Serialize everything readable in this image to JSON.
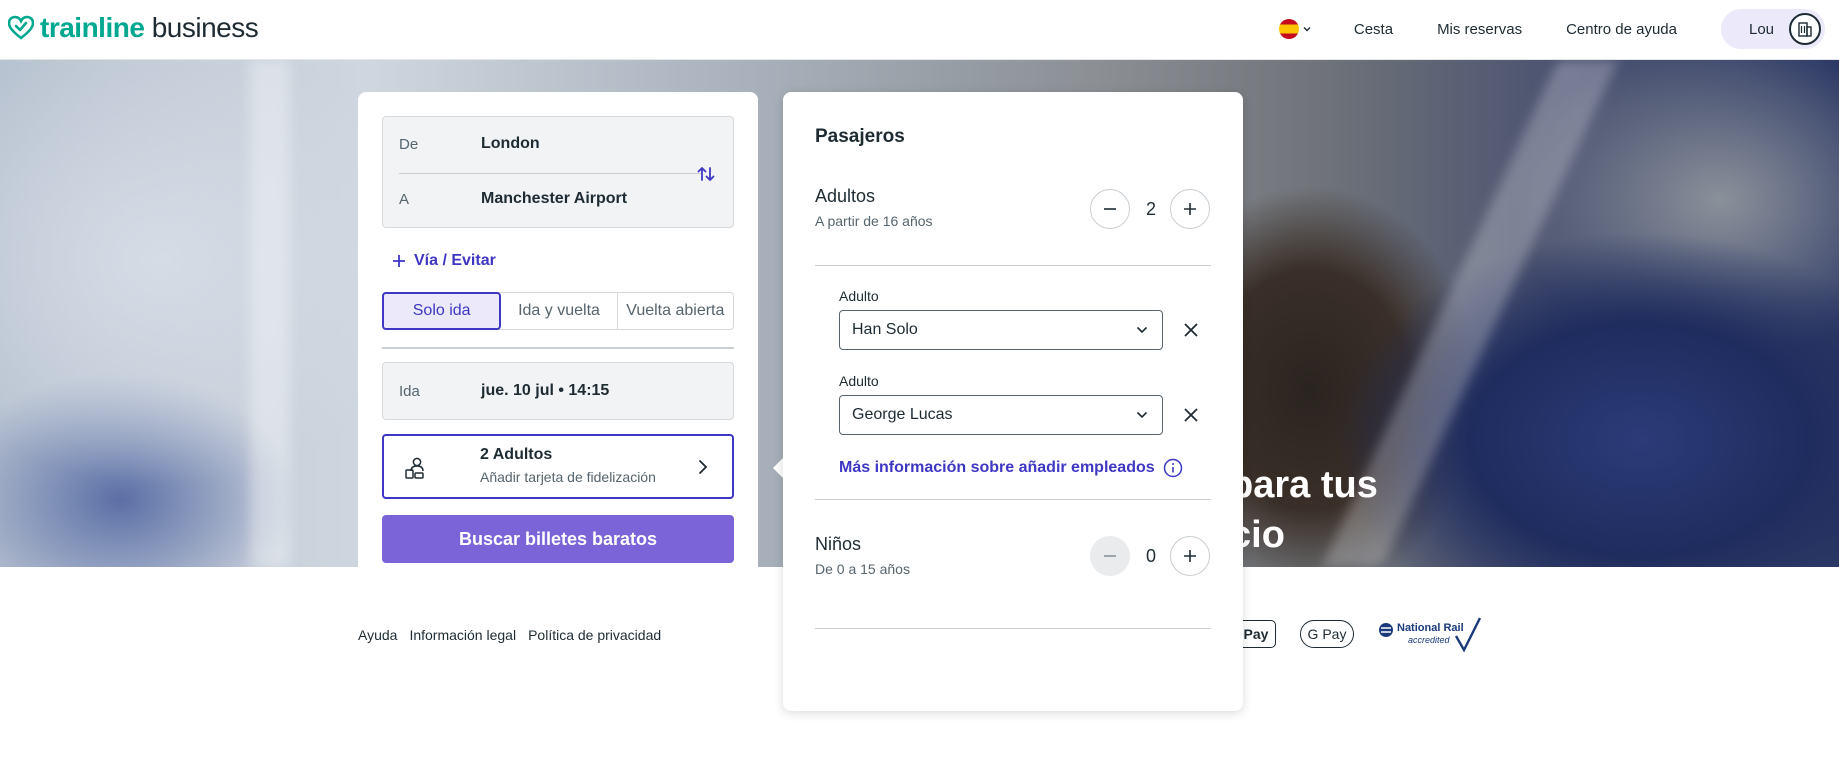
{
  "header": {
    "logo_brand": "trainline",
    "logo_suffix": "business",
    "nav": [
      "Cesta",
      "Mis reservas",
      "Centro de ayuda"
    ],
    "user_name": "Lou"
  },
  "search": {
    "from_label": "De",
    "from_value": "London",
    "to_label": "A",
    "to_value": "Manchester Airport",
    "via_label": "Vía / Evitar",
    "trip_types": [
      "Solo ida",
      "Ida y vuelta",
      "Vuelta abierta"
    ],
    "selected_trip_type": "Solo ida",
    "date_label": "Ida",
    "date_value": "jue. 10 jul • 14:15",
    "passengers_title": "2 Adultos",
    "passengers_sub": "Añadir tarjeta de fidelización",
    "search_button": "Buscar billetes baratos"
  },
  "hero": {
    "text_line1": "para tus",
    "text_line2": "cio"
  },
  "passengers_panel": {
    "title": "Pasajeros",
    "adults_title": "Adultos",
    "adults_sub": "A partir de 16 años",
    "adults_count": "2",
    "adult_entries": [
      {
        "label": "Adulto",
        "name": "Han Solo"
      },
      {
        "label": "Adulto",
        "name": "George Lucas"
      }
    ],
    "info_link": "Más información sobre añadir empleados",
    "children_title": "Niños",
    "children_sub": "De 0 a 15 años",
    "children_count": "0"
  },
  "footer": {
    "links": [
      "Ayuda",
      "Información legal",
      "Política de privacidad"
    ],
    "gpay": "G Pay",
    "applepay": "Pay",
    "national_rail_line1": "National Rail",
    "national_rail_line2": "accredited"
  },
  "colors": {
    "brand": "#00a88f",
    "accent": "#3d37c4",
    "search_button": "#7b64d8"
  }
}
